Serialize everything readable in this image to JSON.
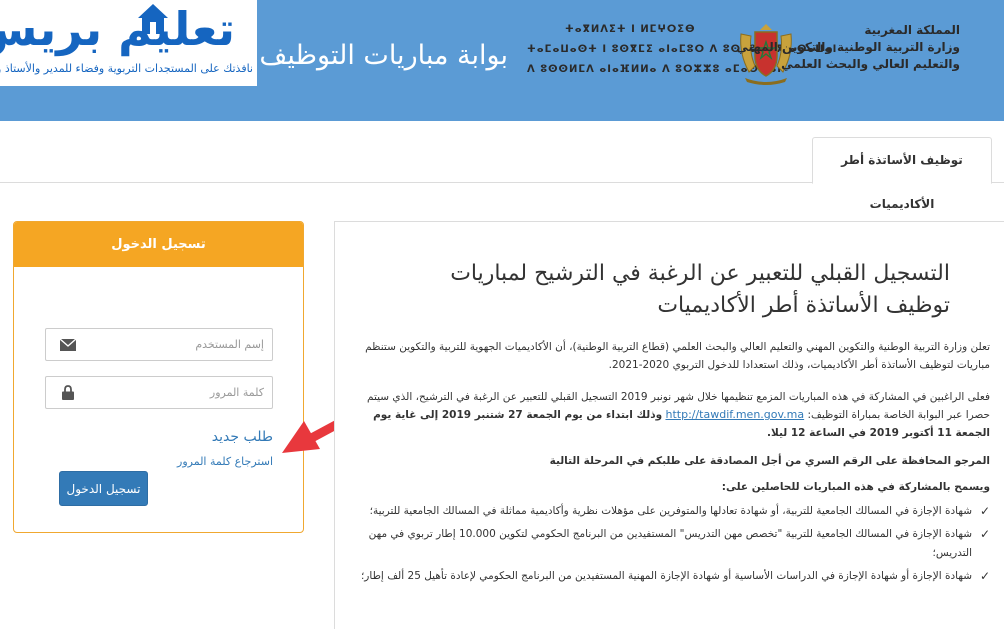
{
  "header": {
    "logo_main": "تعليم بريس",
    "logo_sub": "نافذتك على المستجدات التربوية وفضاء للمدير والأستاذ والتلميذ",
    "portal_title": "بوابة مباريات التوظيف",
    "tifinagh_lines": [
      "ⵜⴰⴳⵍⴷⵉⵜ ⵏ ⵍⵎⵖⵔⵉⴱ",
      "ⵜⴰⵎⴰⵡⴰⵙⵜ ⵏ ⵓⵙⴳⵎⵉ ⴰⵏⴰⵎⵓⵔ ⴷ ⵓⵙⵎⵓⵜⵜⴳ ⴰⵙⴰⵡⴰⵏ",
      "ⴷ ⵓⵙⵙⵍⵎⴷ ⴰⵏⴰⴼⵍⵍⴰ ⴷ ⵓⵔⵣⵣⵓ ⴰⵎⴰⵙⵙⴰⵏ"
    ],
    "ministry_lines": [
      "المملكة المغربية",
      "وزارة التربية الوطنية والتكوين المهني",
      "والتعليم العالي والبحث العلمي"
    ]
  },
  "tabs": [
    {
      "label": "توظيف الأساتذة أطر الأكاديميات",
      "active": true
    }
  ],
  "login": {
    "title": "تسجيل الدخول",
    "username_placeholder": "إسم المستخدم",
    "password_placeholder": "كلمة المرور",
    "new_request": "طلب جديد",
    "recover_password": "استرجاع كلمة المرور",
    "submit": "تسجيل الدخول"
  },
  "content": {
    "title": "التسجيل القبلي للتعبير عن الرغبة في الترشيح لمباريات توظيف الأساتذة أطر الأكاديميات",
    "p1": "تعلن وزارة التربية الوطنية والتكوين المهني والتعليم العالي والبحث العلمي (قطاع التربية الوطنية)، أن الأكاديميات الجهوية للتربية والتكوين ستنظم مباريات لتوظيف الأساتذة أطر الأكاديميات، وذلك استعدادا للدخول التربوي 2020-2021.",
    "p2_a": "فعلى الراغبين في المشاركة في هذه المباريات المزمع تنظيمها خلال شهر نونبر 2019 التسجيل القبلي للتعبير عن الرغبة في الترشيح، الذي سيتم حصرا عبر البوابة الخاصة بمباراة التوظيف:",
    "p2_link": "http://tawdif.men.gov.ma",
    "p2_b": "وذلك ابتداء من يوم الجمعة 27 شتنبر 2019 إلى غاية يوم الجمعة 11 أكتوبر 2019 في الساعة 12 ليلا.",
    "red_note": "المرجو المحافظة على الرقم السري من أجل المصادقة على طلبكم في المرحلة التالية",
    "allowed_heading": "ويسمح بالمشاركة في هذه المباريات للحاصلين على:",
    "conditions": [
      "شهادة الإجازة في المسالك الجامعية للتربية، أو شهادة تعادلها والمتوفرين على مؤهلات نظرية وأكاديمية مماثلة في المسالك الجامعية للتربية؛",
      "شهادة الإجازة في المسالك الجامعية للتربية \"تخصص مهن التدريس\" المستفيدين من البرنامج الحكومي لتكوين 10.000 إطار تربوي في مهن التدريس؛",
      "شهادة الإجازة أو شهادة الإجازة في الدراسات الأساسية أو شهادة الإجازة المهنية المستفيدين من البرنامج الحكومي لإعادة تأهيل 25 ألف إطار؛"
    ]
  },
  "colors": {
    "header_bg": "#5b9bd5",
    "login_header": "#f5a623",
    "primary_button": "#337ab7",
    "link": "#337ab7",
    "warning_text": "#e21b1b",
    "annotation_arrow": "#e8383d"
  }
}
